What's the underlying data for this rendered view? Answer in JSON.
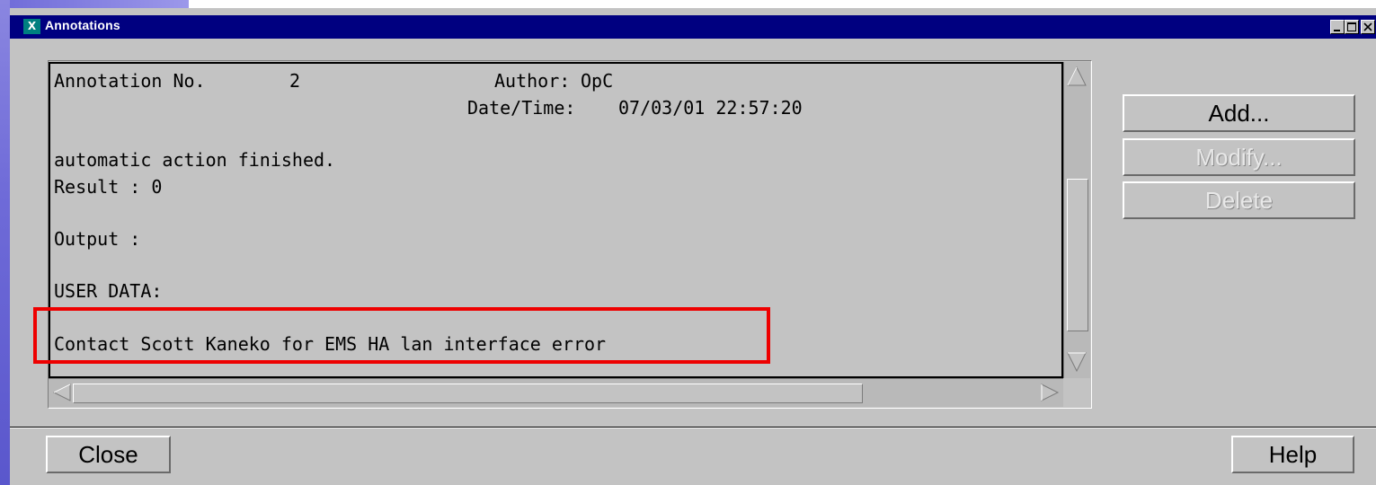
{
  "window": {
    "title": "Annotations",
    "icon_label": "X"
  },
  "annotation": {
    "number_label": "Annotation No.",
    "number": "2",
    "author_label": "Author:",
    "author": "OpC",
    "datetime_label": "Date/Time:",
    "datetime": "07/03/01 22:57:20",
    "lines": [
      "automatic action finished.",
      "Result : 0",
      "Output :",
      "USER DATA:",
      "Contact Scott Kaneko for EMS HA lan interface error"
    ]
  },
  "buttons": {
    "add": "Add...",
    "modify": "Modify...",
    "delete": "Delete",
    "close": "Close",
    "help": "Help"
  },
  "colors": {
    "titlebar": "#000080",
    "window_bg": "#c3c3c3",
    "highlight": "#ee0000"
  },
  "icons": [
    "minimize-icon",
    "maximize-icon",
    "close-icon",
    "arrow-up-icon",
    "arrow-down-icon",
    "arrow-left-icon",
    "arrow-right-icon"
  ]
}
